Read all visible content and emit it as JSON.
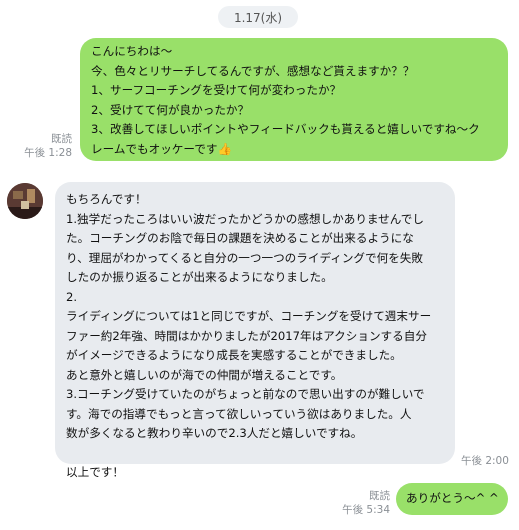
{
  "date_label": "1.17(水)",
  "messages": {
    "m1": {
      "lines": [
        "こんにちわは〜",
        "今、色々とリサーチしてるんですが、感想など貰えますか？？",
        "1、サーフコーチングを受けて何が変わったか？",
        "2、受けてて何が良かったか？",
        "3、改善してほしいポイントやフィードバックも貰えると嬉しいですね〜ク",
        "レームでもオッケーです👍"
      ],
      "read": "既読",
      "time": "午後 1:28"
    },
    "m2": {
      "lines": [
        "もちろんです！",
        "1.独学だったころはいい波だったかどうかの感想しかありませんでし",
        "た。コーチングのお陰で毎日の課題を決めることが出来るようにな",
        "り、理屈がわかってくると自分の一つ一つのライディングで何を失敗",
        "したのか振り返ることが出来るようになりました。",
        "2.",
        "ライディングについては1と同じですが、コーチングを受けて週末サー",
        "ファー約2年強、時間はかかりましたが2017年はアクションする自分",
        "がイメージできるようになり成長を実感することができました。",
        "あと意外と嬉しいのが海での仲間が増えることです。",
        "3.コーチング受けていたのがちょっと前なので思い出すのが難しいで",
        "す。海での指導でもっと言って欲しいっていう欲はありました。人",
        "数が多くなると教わり辛いので2.3人だと嬉しいですね。",
        "",
        "以上です！"
      ],
      "time": "午後 2:00"
    },
    "m3": {
      "lines": [
        "ありがとう〜^ ^"
      ],
      "read": "既読",
      "time": "午後 5:34"
    }
  },
  "colors": {
    "outgoing": "#99e069",
    "incoming": "#e8ebef",
    "meta": "#8a8f95"
  }
}
